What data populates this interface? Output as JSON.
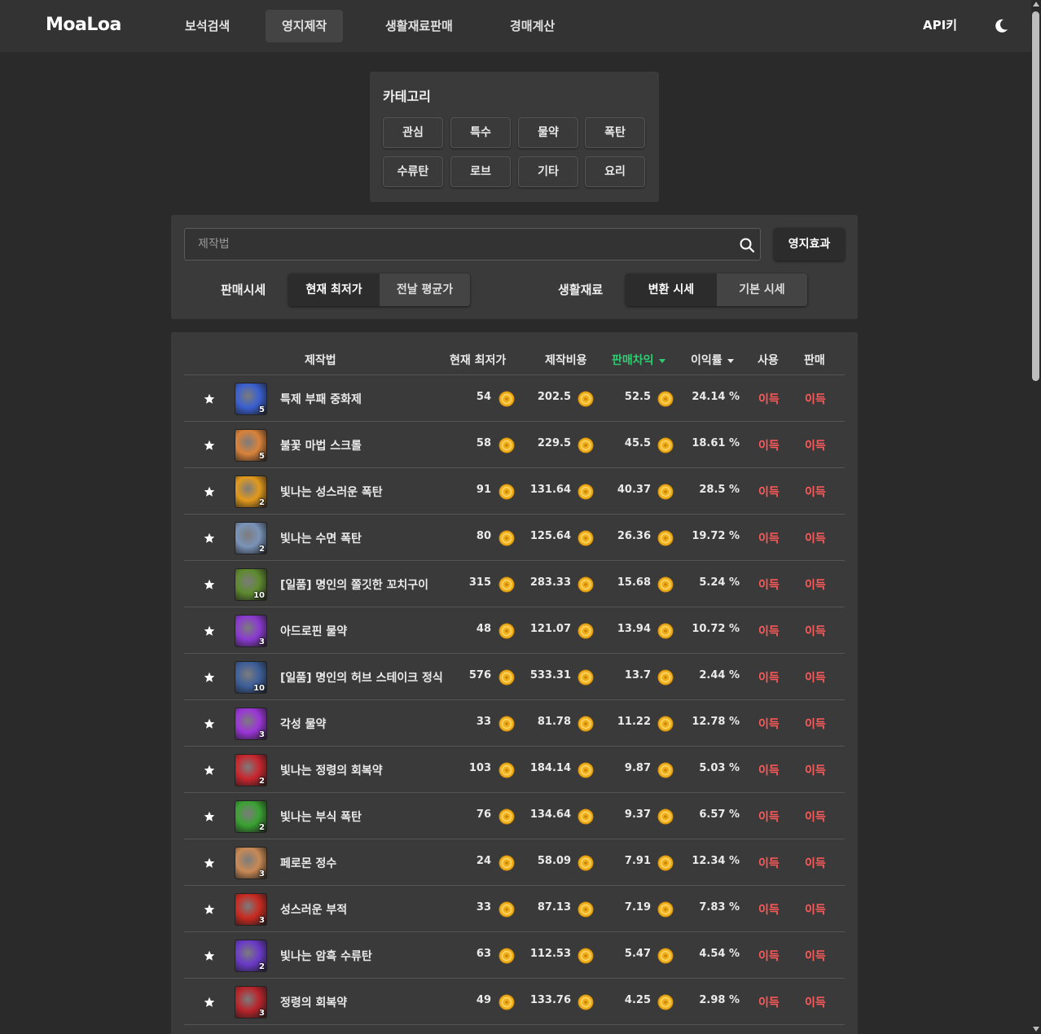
{
  "brand": "MoaLoa",
  "nav": {
    "items": [
      "보석검색",
      "영지제작",
      "생활재료판매",
      "경매계산"
    ],
    "active_index": 1,
    "api_link": "API키"
  },
  "category": {
    "title": "카테고리",
    "buttons": [
      "관심",
      "특수",
      "물약",
      "폭탄",
      "수류탄",
      "로브",
      "기타",
      "요리"
    ]
  },
  "search": {
    "placeholder": "제작법",
    "effect_button": "영지효과"
  },
  "sale_price": {
    "label": "판매시세",
    "options": [
      "현재 최저가",
      "전날 평균가"
    ],
    "selected": "현재 최저가"
  },
  "materials": {
    "label": "생활재료",
    "options": [
      "변환 시세",
      "기본 시세"
    ],
    "selected": "변환 시세"
  },
  "table": {
    "headers": {
      "recipe": "제작법",
      "current_low": "현재 최저가",
      "cost": "제작비용",
      "diff": "판매차익",
      "rate": "이익률",
      "use": "사용",
      "sell": "판매"
    },
    "sorted_by": "판매차익",
    "rows": [
      {
        "name": "특제 부패 중화제",
        "qty": "5",
        "price": "54",
        "cost": "202.5",
        "diff": "52.5",
        "rate": "24.14 %",
        "use": "이득",
        "sell": "이득",
        "icon_color": "#3a5fd0"
      },
      {
        "name": "불꽃 마법 스크롤",
        "qty": "5",
        "price": "58",
        "cost": "229.5",
        "diff": "45.5",
        "rate": "18.61 %",
        "use": "이득",
        "sell": "이득",
        "icon_color": "#d9823a"
      },
      {
        "name": "빛나는 성스러운 폭탄",
        "qty": "2",
        "price": "91",
        "cost": "131.64",
        "diff": "40.37",
        "rate": "28.5 %",
        "use": "이득",
        "sell": "이득",
        "icon_color": "#e39a1c"
      },
      {
        "name": "빛나는 수면 폭탄",
        "qty": "2",
        "price": "80",
        "cost": "125.64",
        "diff": "26.36",
        "rate": "19.72 %",
        "use": "이득",
        "sell": "이득",
        "icon_color": "#7a93b8"
      },
      {
        "name": "[일품] 명인의 쫄깃한 꼬치구이",
        "qty": "10",
        "price": "315",
        "cost": "283.33",
        "diff": "15.68",
        "rate": "5.24 %",
        "use": "이득",
        "sell": "이득",
        "icon_color": "#5e8a2e"
      },
      {
        "name": "아드로핀 물약",
        "qty": "3",
        "price": "48",
        "cost": "121.07",
        "diff": "13.94",
        "rate": "10.72 %",
        "use": "이득",
        "sell": "이득",
        "icon_color": "#8a3ad0"
      },
      {
        "name": "[일품] 명인의 허브 스테이크 정식",
        "qty": "10",
        "price": "576",
        "cost": "533.31",
        "diff": "13.7",
        "rate": "2.44 %",
        "use": "이득",
        "sell": "이득",
        "icon_color": "#3d5f9a"
      },
      {
        "name": "각성 물약",
        "qty": "3",
        "price": "33",
        "cost": "81.78",
        "diff": "11.22",
        "rate": "12.78 %",
        "use": "이득",
        "sell": "이득",
        "icon_color": "#9b35d8"
      },
      {
        "name": "빛나는 정령의 회복약",
        "qty": "2",
        "price": "103",
        "cost": "184.14",
        "diff": "9.87",
        "rate": "5.03 %",
        "use": "이득",
        "sell": "이득",
        "icon_color": "#c8262d"
      },
      {
        "name": "빛나는 부식 폭탄",
        "qty": "2",
        "price": "76",
        "cost": "134.64",
        "diff": "9.37",
        "rate": "6.57 %",
        "use": "이득",
        "sell": "이득",
        "icon_color": "#3aa232"
      },
      {
        "name": "페로몬 정수",
        "qty": "3",
        "price": "24",
        "cost": "58.09",
        "diff": "7.91",
        "rate": "12.34 %",
        "use": "이득",
        "sell": "이득",
        "icon_color": "#c98a55"
      },
      {
        "name": "성스러운 부적",
        "qty": "3",
        "price": "33",
        "cost": "87.13",
        "diff": "7.19",
        "rate": "7.83 %",
        "use": "이득",
        "sell": "이득",
        "icon_color": "#c82a20"
      },
      {
        "name": "빛나는 암흑 수류탄",
        "qty": "2",
        "price": "63",
        "cost": "112.53",
        "diff": "5.47",
        "rate": "4.54 %",
        "use": "이득",
        "sell": "이득",
        "icon_color": "#6a3ac8"
      },
      {
        "name": "정령의 회복약",
        "qty": "3",
        "price": "49",
        "cost": "133.76",
        "diff": "4.25",
        "rate": "2.98 %",
        "use": "이득",
        "sell": "이득",
        "icon_color": "#b8242a"
      }
    ]
  },
  "colors": {
    "background": "#2a2a2a",
    "panel": "#3a3a3a",
    "accent_green": "#2ecc71",
    "profit_red": "#ff5a5a",
    "coin_gold": "#f2b01e"
  },
  "icons": {
    "search": "search-icon",
    "theme": "moon-icon",
    "favorite": "star-icon",
    "currency": "gold-coin-icon"
  }
}
